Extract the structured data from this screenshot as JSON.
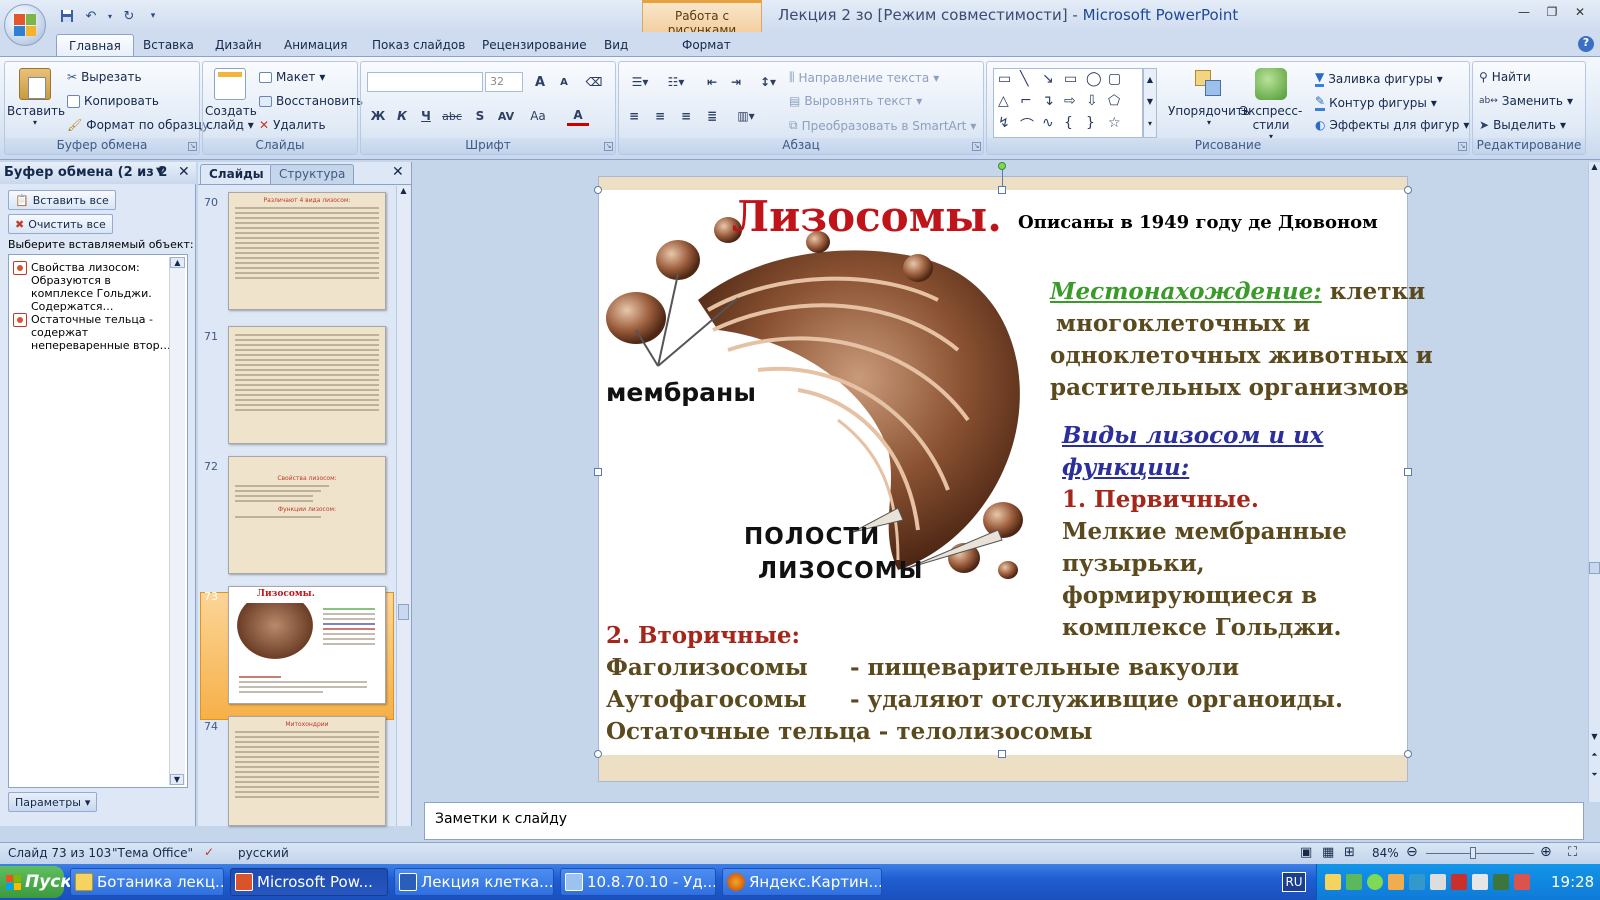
{
  "titlebar": {
    "context_tab": "Работа с рисунками",
    "doc_title": "Лекция 2 зо [Режим совместимости] - ",
    "app_name": "Microsoft PowerPoint"
  },
  "tabs": [
    "Главная",
    "Вставка",
    "Дизайн",
    "Анимация",
    "Показ слайдов",
    "Рецензирование",
    "Вид",
    "Формат"
  ],
  "ribbon": {
    "clipboard": {
      "paste": "Вставить",
      "cut": "Вырезать",
      "copy": "Копировать",
      "format_painter": "Формат по образцу",
      "label": "Буфер обмена"
    },
    "slides": {
      "new_slide_1": "Создать",
      "new_slide_2": "слайд",
      "layout": "Макет",
      "reset": "Восстановить",
      "delete": "Удалить",
      "label": "Слайды"
    },
    "font": {
      "font_name": "",
      "font_size": "32",
      "label": "Шрифт",
      "bold": "Ж",
      "italic": "К",
      "underline": "Ч",
      "strike": "abc",
      "shadow": "S",
      "spacing": "AV",
      "case": "Aa",
      "color": "A",
      "grow": "A",
      "shrink": "A"
    },
    "paragraph": {
      "direction": "Направление текста",
      "align_text": "Выровнять текст",
      "smartart": "Преобразовать в SmartArt",
      "label": "Абзац"
    },
    "drawing": {
      "arrange": "Упорядочить",
      "quick_styles": "Экспресс-стили",
      "fill": "Заливка фигуры",
      "outline": "Контур фигуры",
      "effects": "Эффекты для фигур",
      "label": "Рисование"
    },
    "editing": {
      "find": "Найти",
      "replace": "Заменить",
      "select": "Выделить",
      "label": "Редактирование"
    }
  },
  "clipboard_pane": {
    "title": "Буфер обмена (2 из 2",
    "paste_all": "Вставить все",
    "clear_all": "Очистить все",
    "choose_label": "Выберите вставляемый объект:",
    "items": [
      "Свойства лизосом: Образуются в комплексе Гольджи. Содержатся…",
      "Остаточные тельца - содержат непереваренные втор…"
    ],
    "options": "Параметры"
  },
  "slides_pane": {
    "tab_slides": "Слайды",
    "tab_outline": "Структура",
    "thumbs": [
      {
        "num": "70",
        "title": "Различают 4 вида лизосом:"
      },
      {
        "num": "71",
        "title": ""
      },
      {
        "num": "72",
        "title": "Свойства лизосом:",
        "sub": "Функции лизосом:"
      },
      {
        "num": "73",
        "title": "Лизосомы."
      },
      {
        "num": "74",
        "title": "Митохондрии"
      }
    ]
  },
  "slide": {
    "title": "Лизосомы.",
    "subtitle": "Описаны в 1949 году де Дювоном",
    "label_membranes": "мембраны",
    "label_cavity_1": "ПОЛОСТИ",
    "label_cavity_2": "ЛИЗОСОМЫ",
    "location_head": "Местонахождение:",
    "location_text_1": "клетки",
    "location_text_2": "многоклеточных и",
    "location_text_3": "одноклеточных животных и",
    "location_text_4": "растительных  организмов",
    "types_head_1": "Виды лизосом и их",
    "types_head_2": "функции:",
    "primary_head": "1. Первичные.",
    "primary_1": "Мелкие мембранные",
    "primary_2": "пузырьки,",
    "primary_3": "формирующиеся в",
    "primary_4": "комплексе Гольджи.",
    "secondary_head": "2. Вторичные:",
    "row1_a": "Фаголизосомы",
    "row1_b": "- пищеварительные вакуоли",
    "row2_a": "Аутофагосомы",
    "row2_b": "- удаляют отслуживщие органоиды.",
    "row3": "Остаточные тельца - телолизосомы"
  },
  "notes": "Заметки к слайду",
  "statusbar": {
    "slide_info": "Слайд 73 из 103",
    "theme": "\"Тема Office\"",
    "lang": "русский",
    "zoom": "84%"
  },
  "taskbar": {
    "start": "Пуск",
    "tasks": [
      "Ботаника лекц...",
      "Microsoft Pow...",
      "Лекция клетка...",
      "10.8.70.10 - Уд...",
      "Яндекс.Картин..."
    ],
    "lang": "RU",
    "time": "19:28"
  },
  "colors": {
    "title_red": "#c0141b",
    "location_green": "#3a9a2a",
    "types_blue": "#2b2f9c",
    "olive_text": "#5b4a1d",
    "dark_red": "#a5261b"
  }
}
